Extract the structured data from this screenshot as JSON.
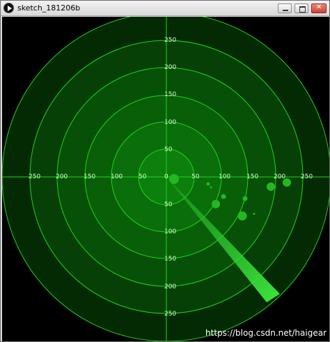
{
  "window": {
    "title": "sketch_181206b"
  },
  "radar": {
    "axis_labels_left": [
      "250",
      "200",
      "150",
      "100",
      "50"
    ],
    "axis_labels_right": [
      "50",
      "100",
      "150",
      "200",
      "250"
    ],
    "axis_labels_up": [
      "250",
      "200",
      "150",
      "100",
      "50"
    ],
    "axis_labels_down": [
      "50",
      "100",
      "150",
      "200",
      "250"
    ],
    "center_label": "0",
    "colors": {
      "background": "#000000",
      "ring": "#1fd51f",
      "fill": "#0d7a0d",
      "blip": "#23b823",
      "sweep": "#2fe02f"
    }
  },
  "watermark": "https://blog.csdn.net/haigear"
}
